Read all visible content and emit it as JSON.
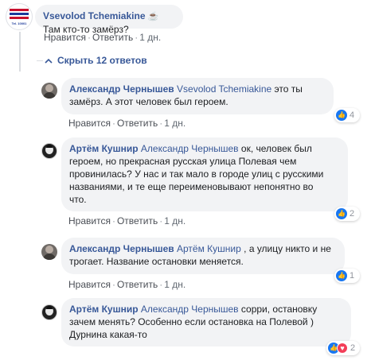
{
  "comments": {
    "top": {
      "author": "Vsevolod Tchemiakine",
      "icon": "coffee-icon",
      "text": "Там кто-то замёрз?",
      "like": "Нравится",
      "reply": "Ответить",
      "time": "1 дн.",
      "avatar_text": "Tel. 10001"
    },
    "hide_replies": "Скрыть 12 ответов",
    "replies": [
      {
        "author": "Александр Чернышев",
        "mention": "Vsevolod Tchemiakine",
        "line1": " это ты",
        "line2": "замёрз. А этот человек был героем.",
        "like": "Нравится",
        "reply": "Ответить",
        "time": "1 дн.",
        "reaction_count": "4"
      },
      {
        "author": "Артём Кушнир",
        "mention": "Александр Чернышев",
        "line1": " ок, человек был",
        "line2": "героем, но прекрасная русская улица Полевая чем",
        "line3": "провинилась? У нас и так мало в городе улиц с русскими",
        "line4": "названиями, и те еще переименовывают непонятно во",
        "line5": "что.",
        "like": "Нравится",
        "reply": "Ответить",
        "time": "1 дн.",
        "reaction_count": "2"
      },
      {
        "author": "Александр Чернышев",
        "mention": "Артём Кушнир",
        "line1": " , а улицу никто и не",
        "line2": "трогает. Название остановки меняется.",
        "like": "Нравится",
        "reply": "Ответить",
        "time": "1 дн.",
        "reaction_count": "1"
      },
      {
        "author": "Артём Кушнир",
        "mention": "Александр Чернышев",
        "line1": " сорри, остановку",
        "line2": "зачем менять? Особенно если остановка на Полевой )",
        "line3": "Дурнина какая-то",
        "reaction_count": "2"
      }
    ]
  },
  "colors": {
    "link": "#385898",
    "bubble": "#f2f3f5",
    "like_blue": "#1877f2",
    "heart_red": "#f33e58"
  }
}
